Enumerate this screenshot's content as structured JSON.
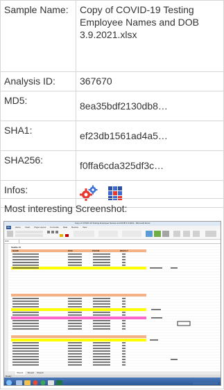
{
  "rows": {
    "sample_name": {
      "label": "Sample Name:",
      "value": "Copy of COVID-19 Testing Employee Names and DOB 3.9.2021.xlsx"
    },
    "analysis_id": {
      "label": "Analysis ID:",
      "value": "367670"
    },
    "md5": {
      "label": "MD5:",
      "value": "8ea35bdf2130db8…"
    },
    "sha1": {
      "label": "SHA1:",
      "value": "ef23db1561ad4a5…"
    },
    "sha256": {
      "label": "SHA256:",
      "value": "f0ffa6cda325df3c…"
    },
    "infos": {
      "label": "Infos:",
      "icons": [
        "gears-icon",
        "grid-app-icon"
      ]
    }
  },
  "most_interesting": {
    "title": "Most interesting Screenshot:",
    "screenshot": {
      "window_title": "Copy of COVID-19 Testing Employee Names and DOB 3.9.2021 - Microsoft Excel",
      "ribbon_tabs": [
        "File",
        "Home",
        "Insert",
        "Page Layout",
        "Formulas",
        "Data",
        "Review",
        "View"
      ],
      "name_box": "C33",
      "sheet_title": "Seattle 10",
      "columns": [
        "NAME",
        "DOB",
        "PHONE",
        "RESULT"
      ],
      "status_left": "Ready",
      "sheet_tabs": [
        "Sheet1",
        "Sheet2",
        "Sheet3"
      ],
      "colors": {
        "excel_green": "#217346",
        "header_orange": "#f4b183",
        "highlight_yellow": "#ffff00",
        "highlight_pink": "#ff66cc",
        "taskbar_blue": "#2b5797"
      }
    }
  }
}
